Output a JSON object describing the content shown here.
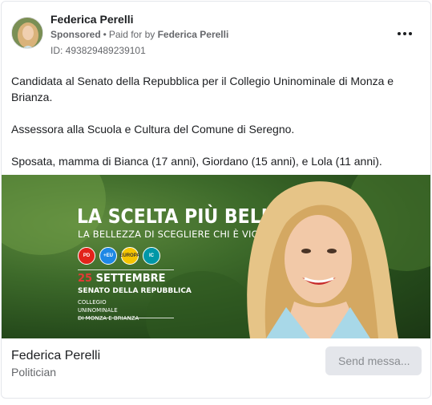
{
  "header": {
    "page_name": "Federica Perelli",
    "sponsored_label": "Sponsored",
    "separator": "•",
    "paid_for_prefix": "Paid for by",
    "paid_for_name": "Federica Perelli",
    "ad_id": "ID: 493829489239101",
    "more_icon": "more-horizontal-icon"
  },
  "body": {
    "paragraphs": [
      "Candidata al Senato della Repubblica per il Collegio Uninominale di Monza e Brianza.",
      "Assessora alla Scuola e Cultura del Comune di Seregno.",
      "Sposata, mamma di Bianca (17 anni), Giordano (15 anni), e Lola (11 anni)."
    ]
  },
  "creative": {
    "headline": "LA SCELTA PIÙ BELLA",
    "subhead": "LA BELLEZZA DI SCEGLIERE CHI È VICINO A TE",
    "logos": [
      {
        "text": "PD",
        "color": "#e2231a"
      },
      {
        "text": "+EU",
        "color": "#1e88e5"
      },
      {
        "text": "EUROPA",
        "color": "#f5c400"
      },
      {
        "text": "IC",
        "color": "#0097a7"
      }
    ],
    "date_number": "25",
    "date_month": "SETTEMBRE",
    "senate": "SENATO DELLA REPUBBLICA",
    "college_line1": "COLLEGIO UNINOMINALE",
    "college_line2": "DI MONZA E BRIANZA"
  },
  "footer": {
    "name": "Federica Perelli",
    "category": "Politician",
    "cta_label": "Send messa..."
  },
  "colors": {
    "primary_text": "#1c1e21",
    "secondary_text": "#65676b",
    "button_bg": "#e4e6eb",
    "accent_red": "#e53935"
  }
}
